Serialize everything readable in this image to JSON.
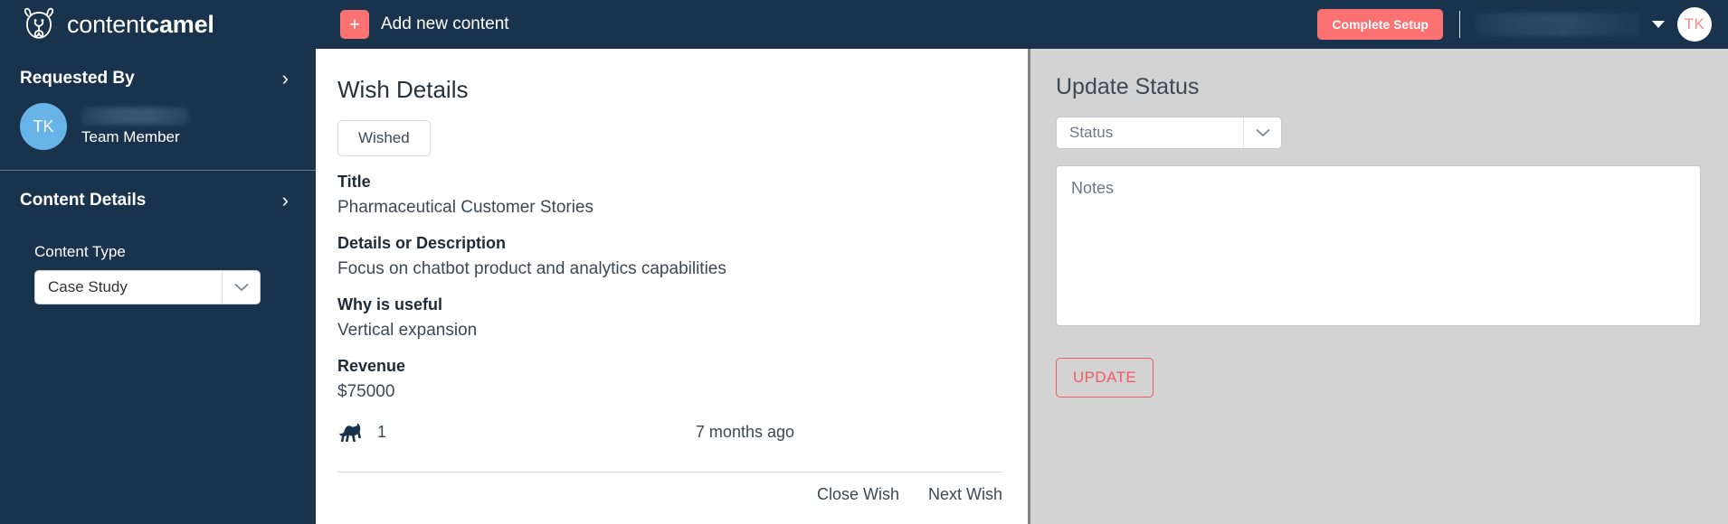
{
  "brand": {
    "name_light": "content",
    "name_bold": "camel",
    "logo_icon": "camel-head-logo"
  },
  "topbar": {
    "add_new_label": "Add new content",
    "plus_icon": "plus-icon",
    "complete_setup_label": "Complete Setup",
    "user_name_redacted": "",
    "caret_icon": "chevron-down-icon",
    "avatar_initials": "TK"
  },
  "sidebar": {
    "requested_by": {
      "heading": "Requested By",
      "chevron_icon": "chevron-right-icon",
      "avatar_initials": "TK",
      "user_name_redacted": "",
      "role": "Team Member"
    },
    "content_details": {
      "heading": "Content Details",
      "chevron_icon": "chevron-right-icon",
      "content_type_label": "Content Type",
      "content_type_value": "Case Study",
      "select_caret_icon": "chevron-down-icon"
    }
  },
  "main": {
    "title": "Wish Details",
    "status_badge": "Wished",
    "fields": [
      {
        "label": "Title",
        "value": "Pharmaceutical Customer Stories"
      },
      {
        "label": "Details or Description",
        "value": "Focus on chatbot product and analytics capabilities"
      },
      {
        "label": "Why is useful",
        "value": "Vertical expansion"
      },
      {
        "label": "Revenue",
        "value": "$75000"
      }
    ],
    "vote": {
      "icon": "camel-icon",
      "count": "1"
    },
    "timestamp": "7 months ago",
    "footer_links": [
      {
        "label": "Close Wish"
      },
      {
        "label": "Next Wish"
      }
    ]
  },
  "right_panel": {
    "title": "Update Status",
    "status_select_placeholder": "Status",
    "status_select_caret_icon": "chevron-down-icon",
    "notes_placeholder": "Notes",
    "notes_value": "",
    "update_button_label": "UPDATE"
  },
  "colors": {
    "navy": "#19334d",
    "coral": "#fc7272",
    "panel_gray": "#d3d3d3",
    "avatar_blue": "#68b3e8",
    "update_red": "#ef5a63"
  }
}
